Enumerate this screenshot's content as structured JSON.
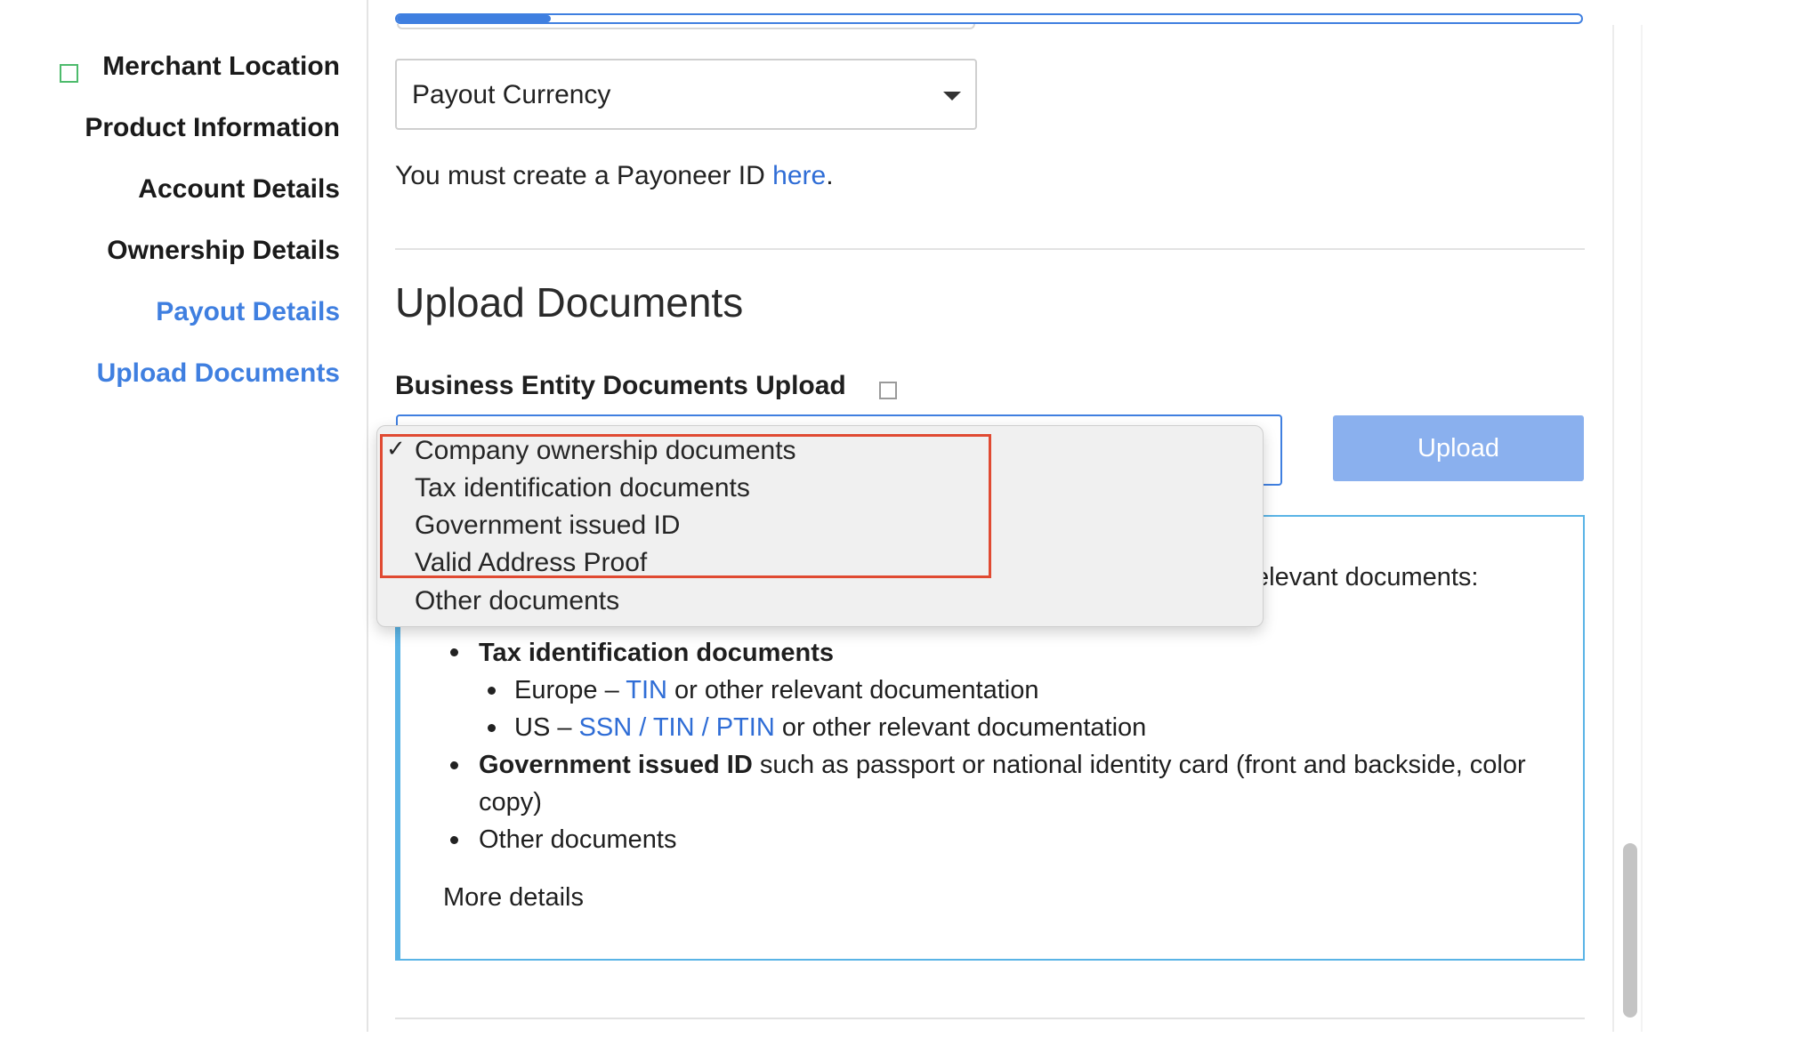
{
  "sidebar": {
    "items": [
      {
        "label": "Merchant Location",
        "active": false,
        "checked": true
      },
      {
        "label": "Product Information",
        "active": false
      },
      {
        "label": "Account Details",
        "active": false
      },
      {
        "label": "Ownership Details",
        "active": false
      },
      {
        "label": "Payout Details",
        "active": true
      },
      {
        "label": "Upload Documents",
        "active": true
      }
    ]
  },
  "progress": {
    "fraction": 0.13
  },
  "payout": {
    "currency_select": {
      "value": "Payout Currency"
    },
    "payoneer_text": "You must create a Payoneer ID ",
    "payoneer_link": "here",
    "payoneer_period": "."
  },
  "upload_section": {
    "title": "Upload Documents",
    "field_label": "Business Entity Documents Upload",
    "upload_button": "Upload"
  },
  "dropdown": {
    "options": [
      {
        "label": "Company ownership documents",
        "selected": true
      },
      {
        "label": "Tax identification documents",
        "selected": false
      },
      {
        "label": "Government issued ID",
        "selected": false
      },
      {
        "label": "Valid Address Proof",
        "selected": false
      },
      {
        "label": "Other documents",
        "selected": false
      }
    ],
    "check_glyph": "✓"
  },
  "info_panel": {
    "partial_text": "elevant documents:",
    "tax_heading": "Tax identification documents",
    "europe_prefix": "Europe – ",
    "europe_link": "TIN",
    "europe_suffix": " or other relevant documentation",
    "us_prefix": "US – ",
    "us_link_ssn": "SSN",
    "us_sep1": " / ",
    "us_link_tin": "TIN",
    "us_sep2": " / ",
    "us_link_ptin": "PTIN",
    "us_suffix": " or other relevant documentation",
    "gov_heading": "Government issued ID",
    "gov_text_line1": " such as passport or national identity card (front and backside, color",
    "gov_text_line2": "copy)",
    "other": "Other documents",
    "more_details": "More details"
  },
  "colors": {
    "accent": "#3f7fe0",
    "link": "#2f6dd6",
    "panel_border": "#5ab4e6",
    "highlight": "#e04a32",
    "upload_button": "#8ab0ee",
    "check_green": "#4dbb6c"
  },
  "icons": {
    "caret": "chevron-down-icon",
    "check": "checkmark-icon",
    "merchant_check": "checkbox-icon"
  }
}
